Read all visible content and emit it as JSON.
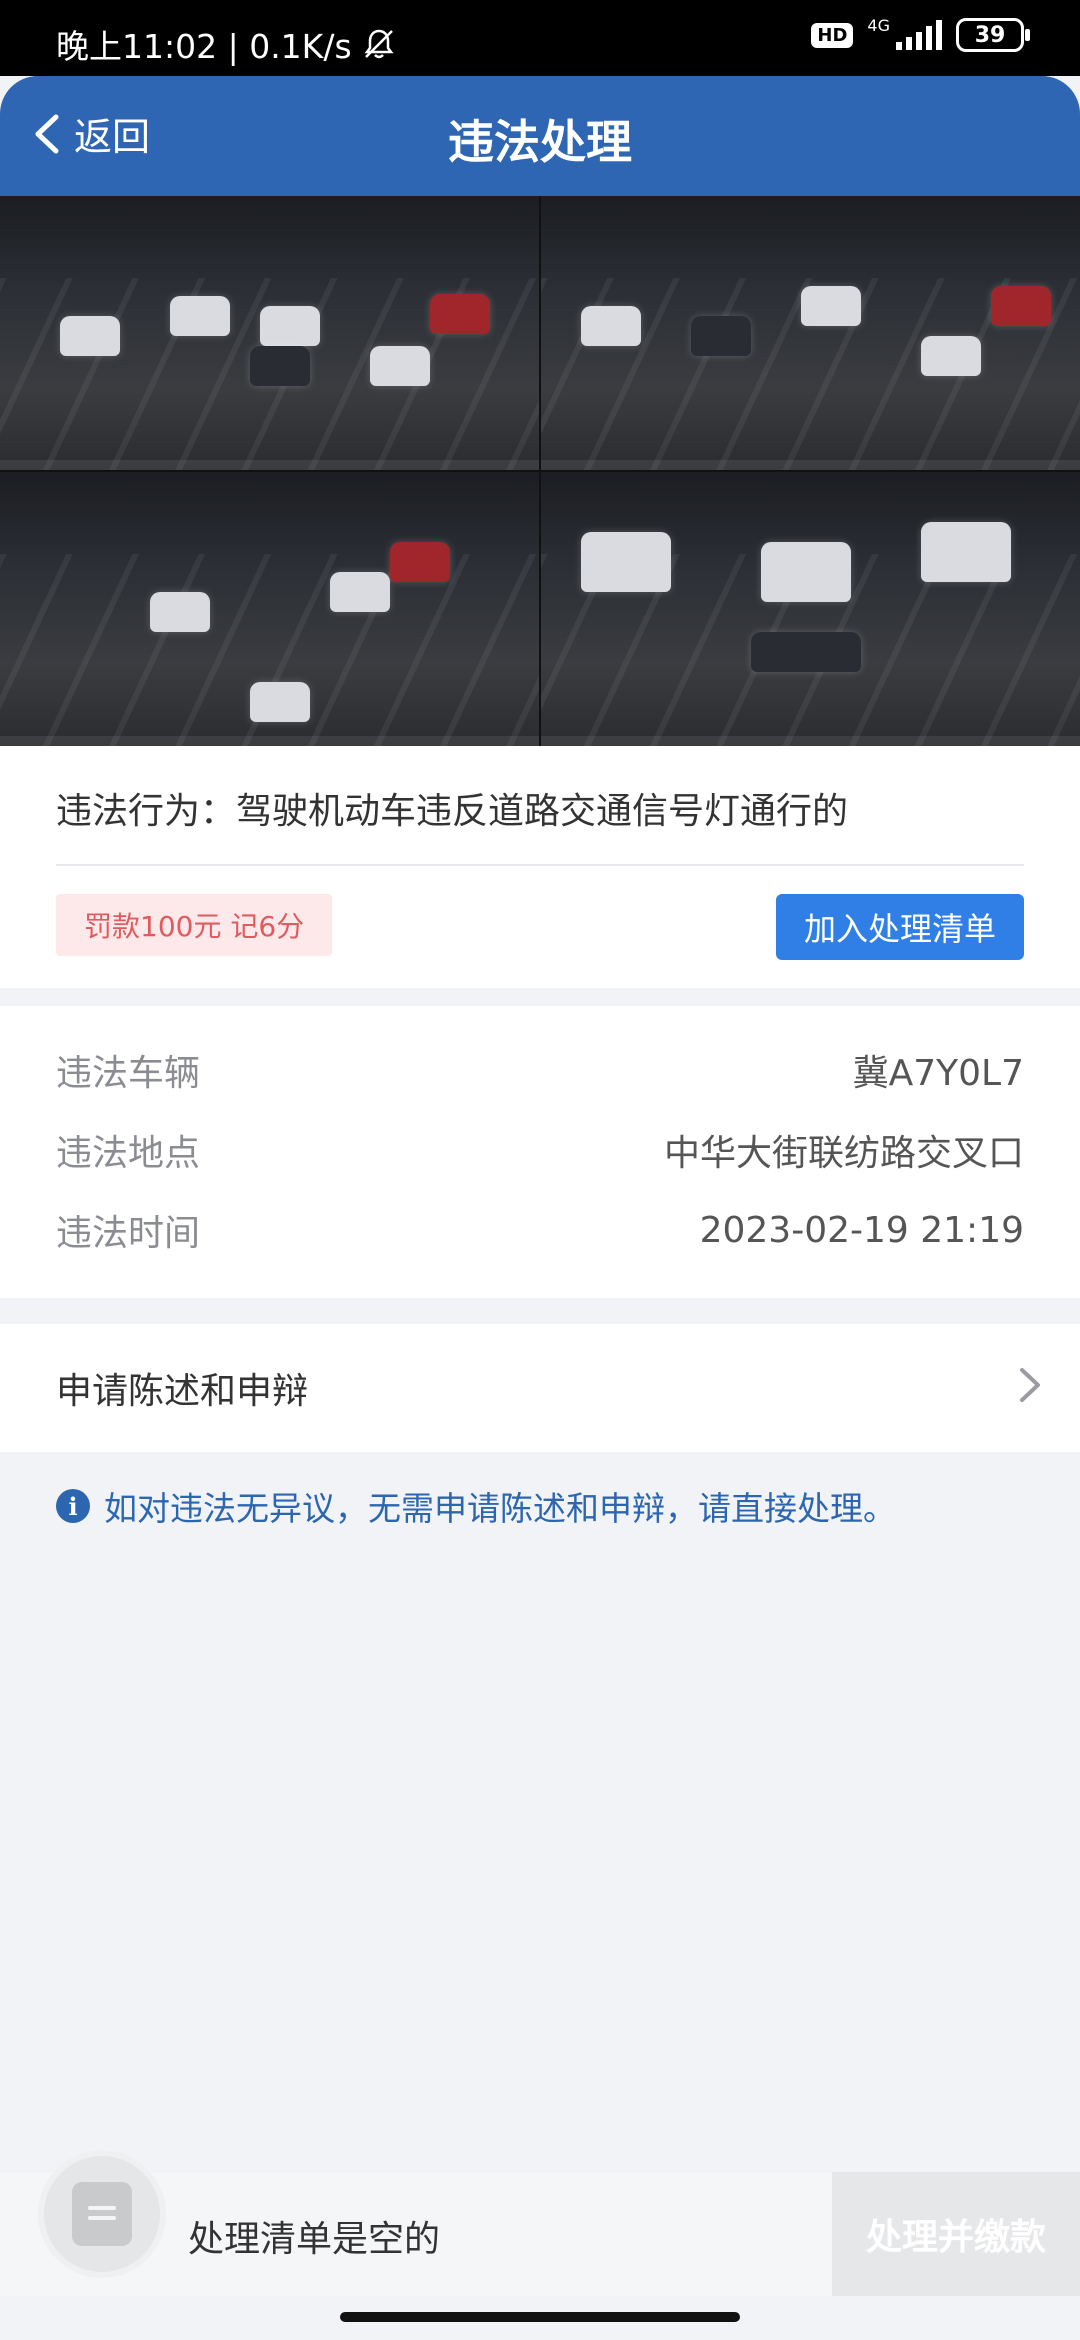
{
  "status_bar": {
    "time": "晚上11:02 | 0.1K/s",
    "hd": "HD",
    "network": "4G",
    "battery": "39"
  },
  "header": {
    "back_label": "返回",
    "title": "违法处理"
  },
  "violation": {
    "behavior": "违法行为：驾驶机动车违反道路交通信号灯通行的",
    "penalty": "罚款100元 记6分",
    "add_button": "加入处理清单"
  },
  "details": {
    "rows": [
      {
        "label": "违法车辆",
        "value": "冀A7Y0L7"
      },
      {
        "label": "违法地点",
        "value": "中华大街联纺路交叉口"
      },
      {
        "label": "违法时间",
        "value": "2023-02-19 21:19"
      }
    ]
  },
  "appeal": {
    "label": "申请陈述和申辩"
  },
  "info": {
    "text": "如对违法无异议，无需申请陈述和申辩，请直接处理。"
  },
  "bottom": {
    "empty_text": "处理清单是空的",
    "pay_button": "处理并缴款"
  },
  "colors": {
    "header": "#2f66b3",
    "primary_button": "#2f7fe7",
    "penalty_bg": "#fde9ea",
    "penalty_text": "#e05b5f",
    "info_text": "#2c66b0"
  }
}
